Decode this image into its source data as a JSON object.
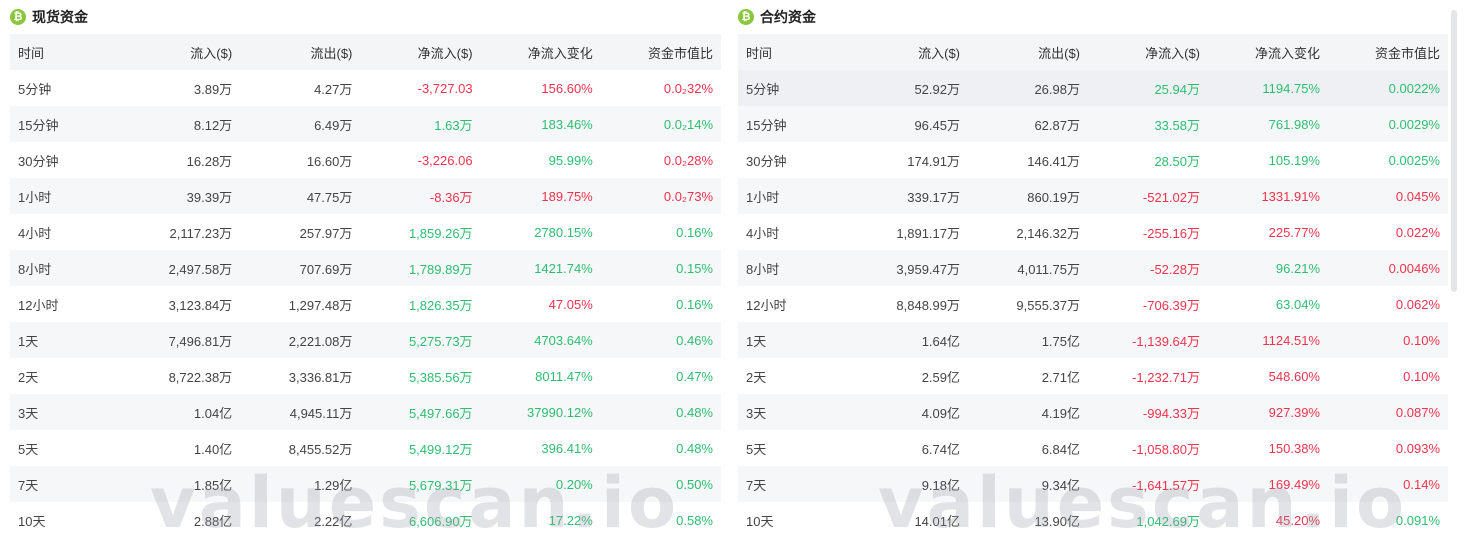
{
  "colors": {
    "up": "#2ebd70",
    "down": "#f0334d",
    "coin": "#8cc63f"
  },
  "watermark": "valuescan.io",
  "columns": [
    "时间",
    "流入($)",
    "流出($)",
    "净流入($)",
    "净流入变化",
    "资金市值比"
  ],
  "spot": {
    "title": "现货资金",
    "coin_icon": "bitcoin-icon",
    "rows": [
      {
        "time": "5分钟",
        "inflow": "3.89万",
        "outflow": "4.27万",
        "net": "-3,727.03",
        "net_dir": "down",
        "change": "156.60%",
        "change_dir": "down",
        "ratio": "0.0₂32%",
        "ratio_dir": "down"
      },
      {
        "time": "15分钟",
        "inflow": "8.12万",
        "outflow": "6.49万",
        "net": "1.63万",
        "net_dir": "up",
        "change": "183.46%",
        "change_dir": "up",
        "ratio": "0.0₂14%",
        "ratio_dir": "up"
      },
      {
        "time": "30分钟",
        "inflow": "16.28万",
        "outflow": "16.60万",
        "net": "-3,226.06",
        "net_dir": "down",
        "change": "95.99%",
        "change_dir": "up",
        "ratio": "0.0₂28%",
        "ratio_dir": "down"
      },
      {
        "time": "1小时",
        "inflow": "39.39万",
        "outflow": "47.75万",
        "net": "-8.36万",
        "net_dir": "down",
        "change": "189.75%",
        "change_dir": "down",
        "ratio": "0.0₂73%",
        "ratio_dir": "down"
      },
      {
        "time": "4小时",
        "inflow": "2,117.23万",
        "outflow": "257.97万",
        "net": "1,859.26万",
        "net_dir": "up",
        "change": "2780.15%",
        "change_dir": "up",
        "ratio": "0.16%",
        "ratio_dir": "up"
      },
      {
        "time": "8小时",
        "inflow": "2,497.58万",
        "outflow": "707.69万",
        "net": "1,789.89万",
        "net_dir": "up",
        "change": "1421.74%",
        "change_dir": "up",
        "ratio": "0.15%",
        "ratio_dir": "up"
      },
      {
        "time": "12小时",
        "inflow": "3,123.84万",
        "outflow": "1,297.48万",
        "net": "1,826.35万",
        "net_dir": "up",
        "change": "47.05%",
        "change_dir": "down",
        "ratio": "0.16%",
        "ratio_dir": "up"
      },
      {
        "time": "1天",
        "inflow": "7,496.81万",
        "outflow": "2,221.08万",
        "net": "5,275.73万",
        "net_dir": "up",
        "change": "4703.64%",
        "change_dir": "up",
        "ratio": "0.46%",
        "ratio_dir": "up"
      },
      {
        "time": "2天",
        "inflow": "8,722.38万",
        "outflow": "3,336.81万",
        "net": "5,385.56万",
        "net_dir": "up",
        "change": "8011.47%",
        "change_dir": "up",
        "ratio": "0.47%",
        "ratio_dir": "up"
      },
      {
        "time": "3天",
        "inflow": "1.04亿",
        "outflow": "4,945.11万",
        "net": "5,497.66万",
        "net_dir": "up",
        "change": "37990.12%",
        "change_dir": "up",
        "ratio": "0.48%",
        "ratio_dir": "up"
      },
      {
        "time": "5天",
        "inflow": "1.40亿",
        "outflow": "8,455.52万",
        "net": "5,499.12万",
        "net_dir": "up",
        "change": "396.41%",
        "change_dir": "up",
        "ratio": "0.48%",
        "ratio_dir": "up"
      },
      {
        "time": "7天",
        "inflow": "1.85亿",
        "outflow": "1.29亿",
        "net": "5,679.31万",
        "net_dir": "up",
        "change": "0.20%",
        "change_dir": "up",
        "ratio": "0.50%",
        "ratio_dir": "up"
      },
      {
        "time": "10天",
        "inflow": "2.88亿",
        "outflow": "2.22亿",
        "net": "6,606.90万",
        "net_dir": "up",
        "change": "17.22%",
        "change_dir": "up",
        "ratio": "0.58%",
        "ratio_dir": "up"
      }
    ]
  },
  "futures": {
    "title": "合约资金",
    "coin_icon": "bitcoin-icon",
    "rows": [
      {
        "time": "5分钟",
        "inflow": "52.92万",
        "outflow": "26.98万",
        "net": "25.94万",
        "net_dir": "up",
        "change": "1194.75%",
        "change_dir": "up",
        "ratio": "0.0022%",
        "ratio_dir": "up"
      },
      {
        "time": "15分钟",
        "inflow": "96.45万",
        "outflow": "62.87万",
        "net": "33.58万",
        "net_dir": "up",
        "change": "761.98%",
        "change_dir": "up",
        "ratio": "0.0029%",
        "ratio_dir": "up"
      },
      {
        "time": "30分钟",
        "inflow": "174.91万",
        "outflow": "146.41万",
        "net": "28.50万",
        "net_dir": "up",
        "change": "105.19%",
        "change_dir": "up",
        "ratio": "0.0025%",
        "ratio_dir": "up"
      },
      {
        "time": "1小时",
        "inflow": "339.17万",
        "outflow": "860.19万",
        "net": "-521.02万",
        "net_dir": "down",
        "change": "1331.91%",
        "change_dir": "down",
        "ratio": "0.045%",
        "ratio_dir": "down"
      },
      {
        "time": "4小时",
        "inflow": "1,891.17万",
        "outflow": "2,146.32万",
        "net": "-255.16万",
        "net_dir": "down",
        "change": "225.77%",
        "change_dir": "down",
        "ratio": "0.022%",
        "ratio_dir": "down"
      },
      {
        "time": "8小时",
        "inflow": "3,959.47万",
        "outflow": "4,011.75万",
        "net": "-52.28万",
        "net_dir": "down",
        "change": "96.21%",
        "change_dir": "up",
        "ratio": "0.0046%",
        "ratio_dir": "down"
      },
      {
        "time": "12小时",
        "inflow": "8,848.99万",
        "outflow": "9,555.37万",
        "net": "-706.39万",
        "net_dir": "down",
        "change": "63.04%",
        "change_dir": "up",
        "ratio": "0.062%",
        "ratio_dir": "down"
      },
      {
        "time": "1天",
        "inflow": "1.64亿",
        "outflow": "1.75亿",
        "net": "-1,139.64万",
        "net_dir": "down",
        "change": "1124.51%",
        "change_dir": "down",
        "ratio": "0.10%",
        "ratio_dir": "down"
      },
      {
        "time": "2天",
        "inflow": "2.59亿",
        "outflow": "2.71亿",
        "net": "-1,232.71万",
        "net_dir": "down",
        "change": "548.60%",
        "change_dir": "down",
        "ratio": "0.10%",
        "ratio_dir": "down"
      },
      {
        "time": "3天",
        "inflow": "4.09亿",
        "outflow": "4.19亿",
        "net": "-994.33万",
        "net_dir": "down",
        "change": "927.39%",
        "change_dir": "down",
        "ratio": "0.087%",
        "ratio_dir": "down"
      },
      {
        "time": "5天",
        "inflow": "6.74亿",
        "outflow": "6.84亿",
        "net": "-1,058.80万",
        "net_dir": "down",
        "change": "150.38%",
        "change_dir": "down",
        "ratio": "0.093%",
        "ratio_dir": "down"
      },
      {
        "time": "7天",
        "inflow": "9.18亿",
        "outflow": "9.34亿",
        "net": "-1,641.57万",
        "net_dir": "down",
        "change": "169.49%",
        "change_dir": "down",
        "ratio": "0.14%",
        "ratio_dir": "down"
      },
      {
        "time": "10天",
        "inflow": "14.01亿",
        "outflow": "13.90亿",
        "net": "1,042.69万",
        "net_dir": "up",
        "change": "45.20%",
        "change_dir": "down",
        "ratio": "0.091%",
        "ratio_dir": "up"
      }
    ]
  }
}
